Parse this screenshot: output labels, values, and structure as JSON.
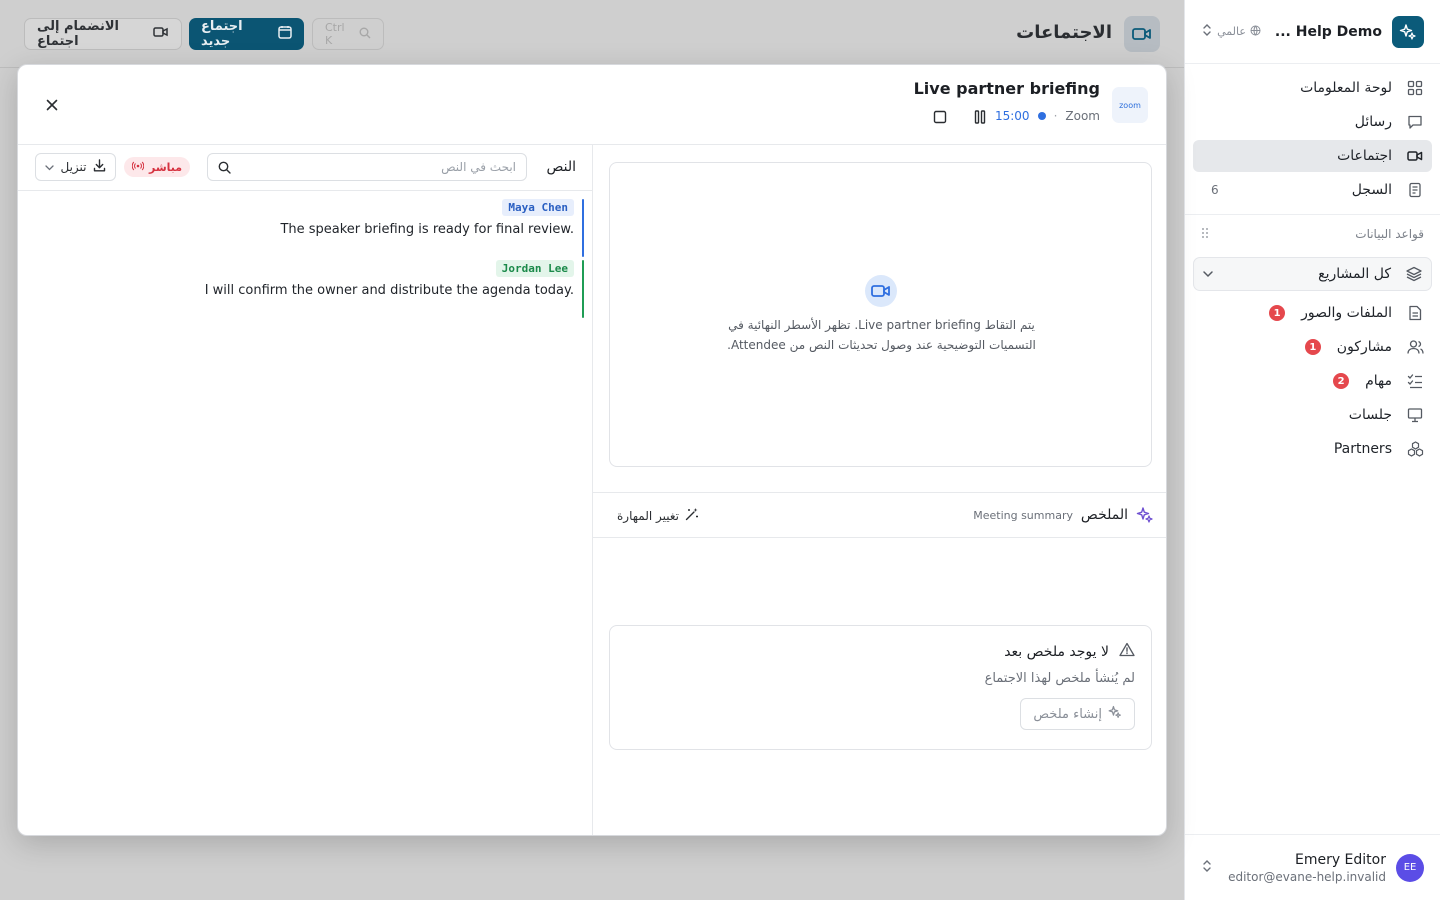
{
  "workspace": {
    "name": "Help Demo ...",
    "scope": "عالمي"
  },
  "nav": [
    {
      "label": "لوحة المعلومات",
      "icon": "dashboard-icon"
    },
    {
      "label": "رسائل",
      "icon": "chat-icon"
    },
    {
      "label": "اجتماعات",
      "icon": "video-icon",
      "active": true
    },
    {
      "label": "السجل",
      "icon": "log-icon",
      "count": "6"
    }
  ],
  "databases": {
    "heading": "قواعد البيانات",
    "project": "كل المشاريع",
    "items": [
      {
        "label": "الملفات والصور",
        "badge": "1"
      },
      {
        "label": "مشاركون",
        "badge": "1"
      },
      {
        "label": "مهام",
        "badge": "2"
      },
      {
        "label": "جلسات"
      },
      {
        "label": "Partners"
      }
    ]
  },
  "user": {
    "initials": "EE",
    "name": "Emery Editor",
    "email": "editor@evane-help.invalid"
  },
  "page": {
    "title": "الاجتماعات",
    "join_label": "الانضمام إلى اجتماع",
    "new_label": "اجتماع جديد",
    "shortcut": "Ctrl K"
  },
  "meeting": {
    "logo_text": "zoom",
    "title": "Live partner briefing",
    "platform": "Zoom",
    "time": "15:00"
  },
  "transcript": {
    "label": "النص",
    "search_placeholder": "ابحث في النص",
    "live_label": "مباشر",
    "download_label": "تنزيل",
    "segments": [
      {
        "speaker": "Maya Chen",
        "text": "The speaker briefing is ready for final review."
      },
      {
        "speaker": "Jordan Lee",
        "text": "I will confirm the owner and distribute the agenda today."
      }
    ]
  },
  "video": {
    "line1": "يتم التقاط Live partner briefing. تظهر الأسطر النهائية في",
    "line2": "التسميات التوضيحية عند وصول تحديثات النص من Attendee."
  },
  "summary": {
    "title": "الملخص",
    "subtitle": "Meeting summary",
    "skill_label": "تغيير المهارة",
    "empty_title": "لا يوجد ملخص بعد",
    "empty_text": "لم يُنشأ ملخص لهذا الاجتماع",
    "generate_label": "إنشاء ملخص"
  },
  "colors": {
    "accent": "#0b5b7a",
    "live": "#d63341",
    "link": "#2f6fe0",
    "speaker1": "#2f6fe0",
    "speaker2": "#1f9d55"
  }
}
